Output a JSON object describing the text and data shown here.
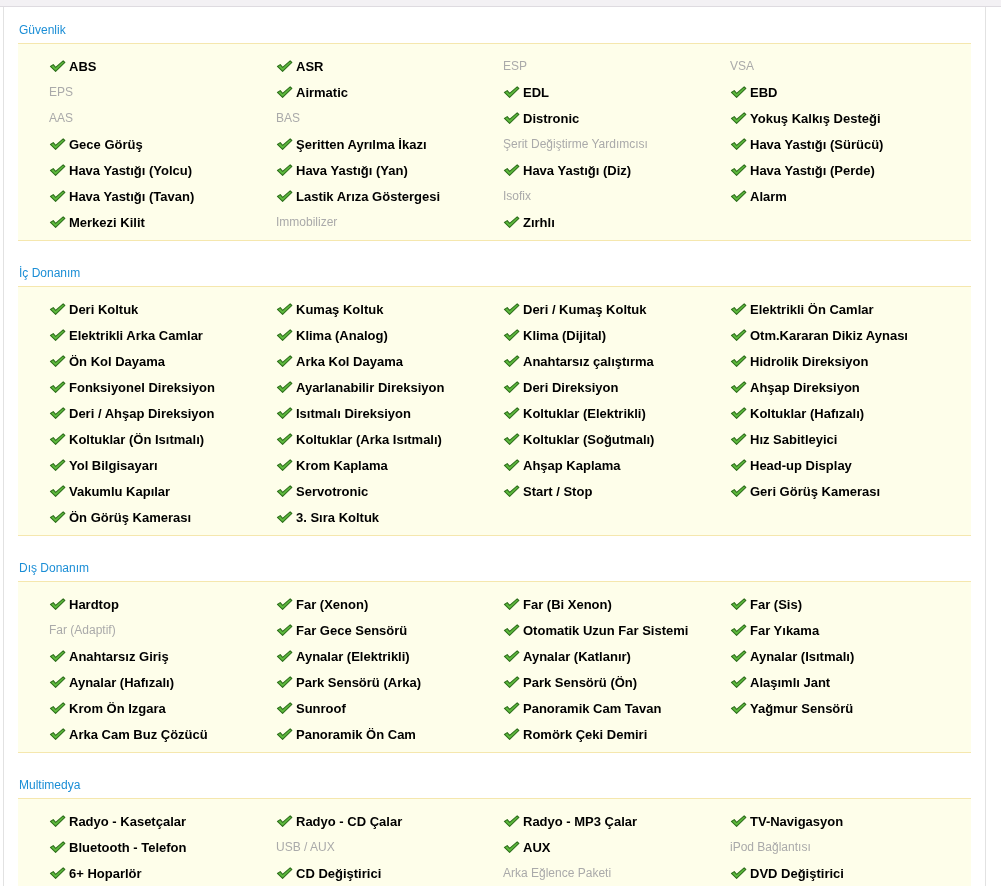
{
  "sections": [
    {
      "title": "Güvenlik",
      "items": [
        {
          "label": "ABS",
          "checked": true
        },
        {
          "label": "ASR",
          "checked": true
        },
        {
          "label": "ESP",
          "checked": false
        },
        {
          "label": "VSA",
          "checked": false
        },
        {
          "label": "EPS",
          "checked": false
        },
        {
          "label": "Airmatic",
          "checked": true
        },
        {
          "label": "EDL",
          "checked": true
        },
        {
          "label": "EBD",
          "checked": true
        },
        {
          "label": "AAS",
          "checked": false
        },
        {
          "label": "BAS",
          "checked": false
        },
        {
          "label": "Distronic",
          "checked": true
        },
        {
          "label": "Yokuş Kalkış Desteği",
          "checked": true
        },
        {
          "label": "Gece Görüş",
          "checked": true
        },
        {
          "label": "Şeritten Ayrılma İkazı",
          "checked": true
        },
        {
          "label": "Şerit Değiştirme Yardımcısı",
          "checked": false
        },
        {
          "label": "Hava Yastığı (Sürücü)",
          "checked": true
        },
        {
          "label": "Hava Yastığı (Yolcu)",
          "checked": true
        },
        {
          "label": "Hava Yastığı (Yan)",
          "checked": true
        },
        {
          "label": "Hava Yastığı (Diz)",
          "checked": true
        },
        {
          "label": "Hava Yastığı (Perde)",
          "checked": true
        },
        {
          "label": "Hava Yastığı (Tavan)",
          "checked": true
        },
        {
          "label": "Lastik Arıza Göstergesi",
          "checked": true
        },
        {
          "label": "Isofix",
          "checked": false
        },
        {
          "label": "Alarm",
          "checked": true
        },
        {
          "label": "Merkezi Kilit",
          "checked": true
        },
        {
          "label": "Immobilizer",
          "checked": false
        },
        {
          "label": "Zırhlı",
          "checked": true
        }
      ]
    },
    {
      "title": "İç Donanım",
      "items": [
        {
          "label": "Deri Koltuk",
          "checked": true
        },
        {
          "label": "Kumaş Koltuk",
          "checked": true
        },
        {
          "label": "Deri / Kumaş Koltuk",
          "checked": true
        },
        {
          "label": "Elektrikli Ön Camlar",
          "checked": true
        },
        {
          "label": "Elektrikli Arka Camlar",
          "checked": true
        },
        {
          "label": "Klima (Analog)",
          "checked": true
        },
        {
          "label": "Klima (Dijital)",
          "checked": true
        },
        {
          "label": "Otm.Kararan Dikiz Aynası",
          "checked": true
        },
        {
          "label": "Ön Kol Dayama",
          "checked": true
        },
        {
          "label": "Arka Kol Dayama",
          "checked": true
        },
        {
          "label": "Anahtarsız çalıştırma",
          "checked": true
        },
        {
          "label": "Hidrolik Direksiyon",
          "checked": true
        },
        {
          "label": "Fonksiyonel Direksiyon",
          "checked": true
        },
        {
          "label": "Ayarlanabilir Direksiyon",
          "checked": true
        },
        {
          "label": "Deri Direksiyon",
          "checked": true
        },
        {
          "label": "Ahşap Direksiyon",
          "checked": true
        },
        {
          "label": "Deri / Ahşap Direksiyon",
          "checked": true
        },
        {
          "label": "Isıtmalı Direksiyon",
          "checked": true
        },
        {
          "label": "Koltuklar (Elektrikli)",
          "checked": true
        },
        {
          "label": "Koltuklar (Hafızalı)",
          "checked": true
        },
        {
          "label": "Koltuklar (Ön Isıtmalı)",
          "checked": true
        },
        {
          "label": "Koltuklar (Arka Isıtmalı)",
          "checked": true
        },
        {
          "label": "Koltuklar (Soğutmalı)",
          "checked": true
        },
        {
          "label": "Hız Sabitleyici",
          "checked": true
        },
        {
          "label": "Yol Bilgisayarı",
          "checked": true
        },
        {
          "label": "Krom Kaplama",
          "checked": true
        },
        {
          "label": "Ahşap Kaplama",
          "checked": true
        },
        {
          "label": "Head-up Display",
          "checked": true
        },
        {
          "label": "Vakumlu Kapılar",
          "checked": true
        },
        {
          "label": "Servotronic",
          "checked": true
        },
        {
          "label": "Start / Stop",
          "checked": true
        },
        {
          "label": "Geri Görüş Kamerası",
          "checked": true
        },
        {
          "label": "Ön Görüş Kamerası",
          "checked": true
        },
        {
          "label": "3. Sıra Koltuk",
          "checked": true
        }
      ]
    },
    {
      "title": "Dış Donanım",
      "items": [
        {
          "label": "Hardtop",
          "checked": true
        },
        {
          "label": "Far (Xenon)",
          "checked": true
        },
        {
          "label": "Far (Bi Xenon)",
          "checked": true
        },
        {
          "label": "Far (Sis)",
          "checked": true
        },
        {
          "label": "Far (Adaptif)",
          "checked": false
        },
        {
          "label": "Far Gece Sensörü",
          "checked": true
        },
        {
          "label": "Otomatik Uzun Far Sistemi",
          "checked": true
        },
        {
          "label": "Far Yıkama",
          "checked": true
        },
        {
          "label": "Anahtarsız Giriş",
          "checked": true
        },
        {
          "label": "Aynalar (Elektrikli)",
          "checked": true
        },
        {
          "label": "Aynalar (Katlanır)",
          "checked": true
        },
        {
          "label": "Aynalar (Isıtmalı)",
          "checked": true
        },
        {
          "label": "Aynalar (Hafızalı)",
          "checked": true
        },
        {
          "label": "Park Sensörü (Arka)",
          "checked": true
        },
        {
          "label": "Park Sensörü (Ön)",
          "checked": true
        },
        {
          "label": "Alaşımlı Jant",
          "checked": true
        },
        {
          "label": "Krom Ön Izgara",
          "checked": true
        },
        {
          "label": "Sunroof",
          "checked": true
        },
        {
          "label": "Panoramik Cam Tavan",
          "checked": true
        },
        {
          "label": "Yağmur Sensörü",
          "checked": true
        },
        {
          "label": "Arka Cam Buz Çözücü",
          "checked": true
        },
        {
          "label": "Panoramik Ön Cam",
          "checked": true
        },
        {
          "label": "Romörk Çeki Demiri",
          "checked": true
        }
      ]
    },
    {
      "title": "Multimedya",
      "items": [
        {
          "label": "Radyo - Kasetçalar",
          "checked": true
        },
        {
          "label": "Radyo - CD Çalar",
          "checked": true
        },
        {
          "label": "Radyo - MP3 Çalar",
          "checked": true
        },
        {
          "label": "TV-Navigasyon",
          "checked": true
        },
        {
          "label": "Bluetooth - Telefon",
          "checked": true
        },
        {
          "label": "USB / AUX",
          "checked": false
        },
        {
          "label": "AUX",
          "checked": true
        },
        {
          "label": "iPod Bağlantısı",
          "checked": false
        },
        {
          "label": "6+ Hoparlör",
          "checked": true
        },
        {
          "label": "CD Değiştirici",
          "checked": true
        },
        {
          "label": "Arka Eğlence Paketi",
          "checked": false
        },
        {
          "label": "DVD Değiştirici",
          "checked": true
        }
      ]
    }
  ]
}
